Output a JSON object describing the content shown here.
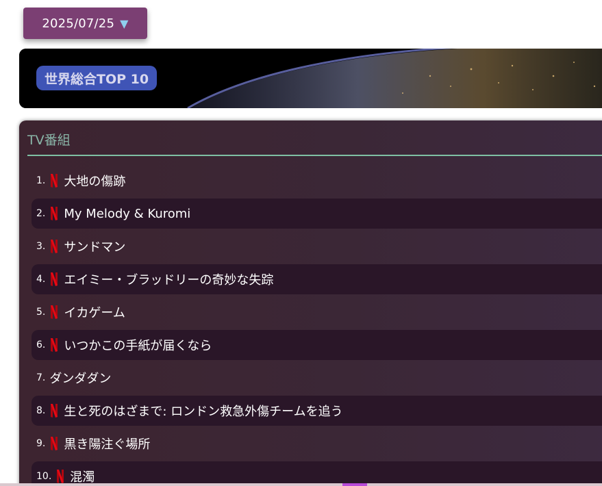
{
  "date_selector": {
    "label": "2025/07/25",
    "caret": "▼"
  },
  "banner": {
    "badge": "世界総合TOP 10"
  },
  "section": {
    "title": "TV番組",
    "items": [
      {
        "rank": "1.",
        "title": "大地の傷跡",
        "netflix": true
      },
      {
        "rank": "2.",
        "title": "My Melody & Kuromi",
        "netflix": true
      },
      {
        "rank": "3.",
        "title": "サンドマン",
        "netflix": true
      },
      {
        "rank": "4.",
        "title": "エイミー・ブラッドリーの奇妙な失踪",
        "netflix": true
      },
      {
        "rank": "5.",
        "title": "イカゲーム",
        "netflix": true
      },
      {
        "rank": "6.",
        "title": "いつかこの手紙が届くなら",
        "netflix": true
      },
      {
        "rank": "7.",
        "title": "ダンダダン",
        "netflix": false
      },
      {
        "rank": "8.",
        "title": "生と死のはざまで: ロンドン救急外傷チームを追う",
        "netflix": true
      },
      {
        "rank": "9.",
        "title": "黒き陽注ぐ場所",
        "netflix": true
      },
      {
        "rank": "10.",
        "title": "混濁",
        "netflix": true
      }
    ]
  },
  "colors": {
    "date_button": "#7b3f73",
    "badge": "#3f54b6",
    "section_title": "#8ab6a8",
    "rule": "#7fc0a4",
    "netflix_red": "#e50914"
  },
  "icons": {
    "netflix": "netflix-n-icon",
    "caret": "caret-down-icon"
  }
}
